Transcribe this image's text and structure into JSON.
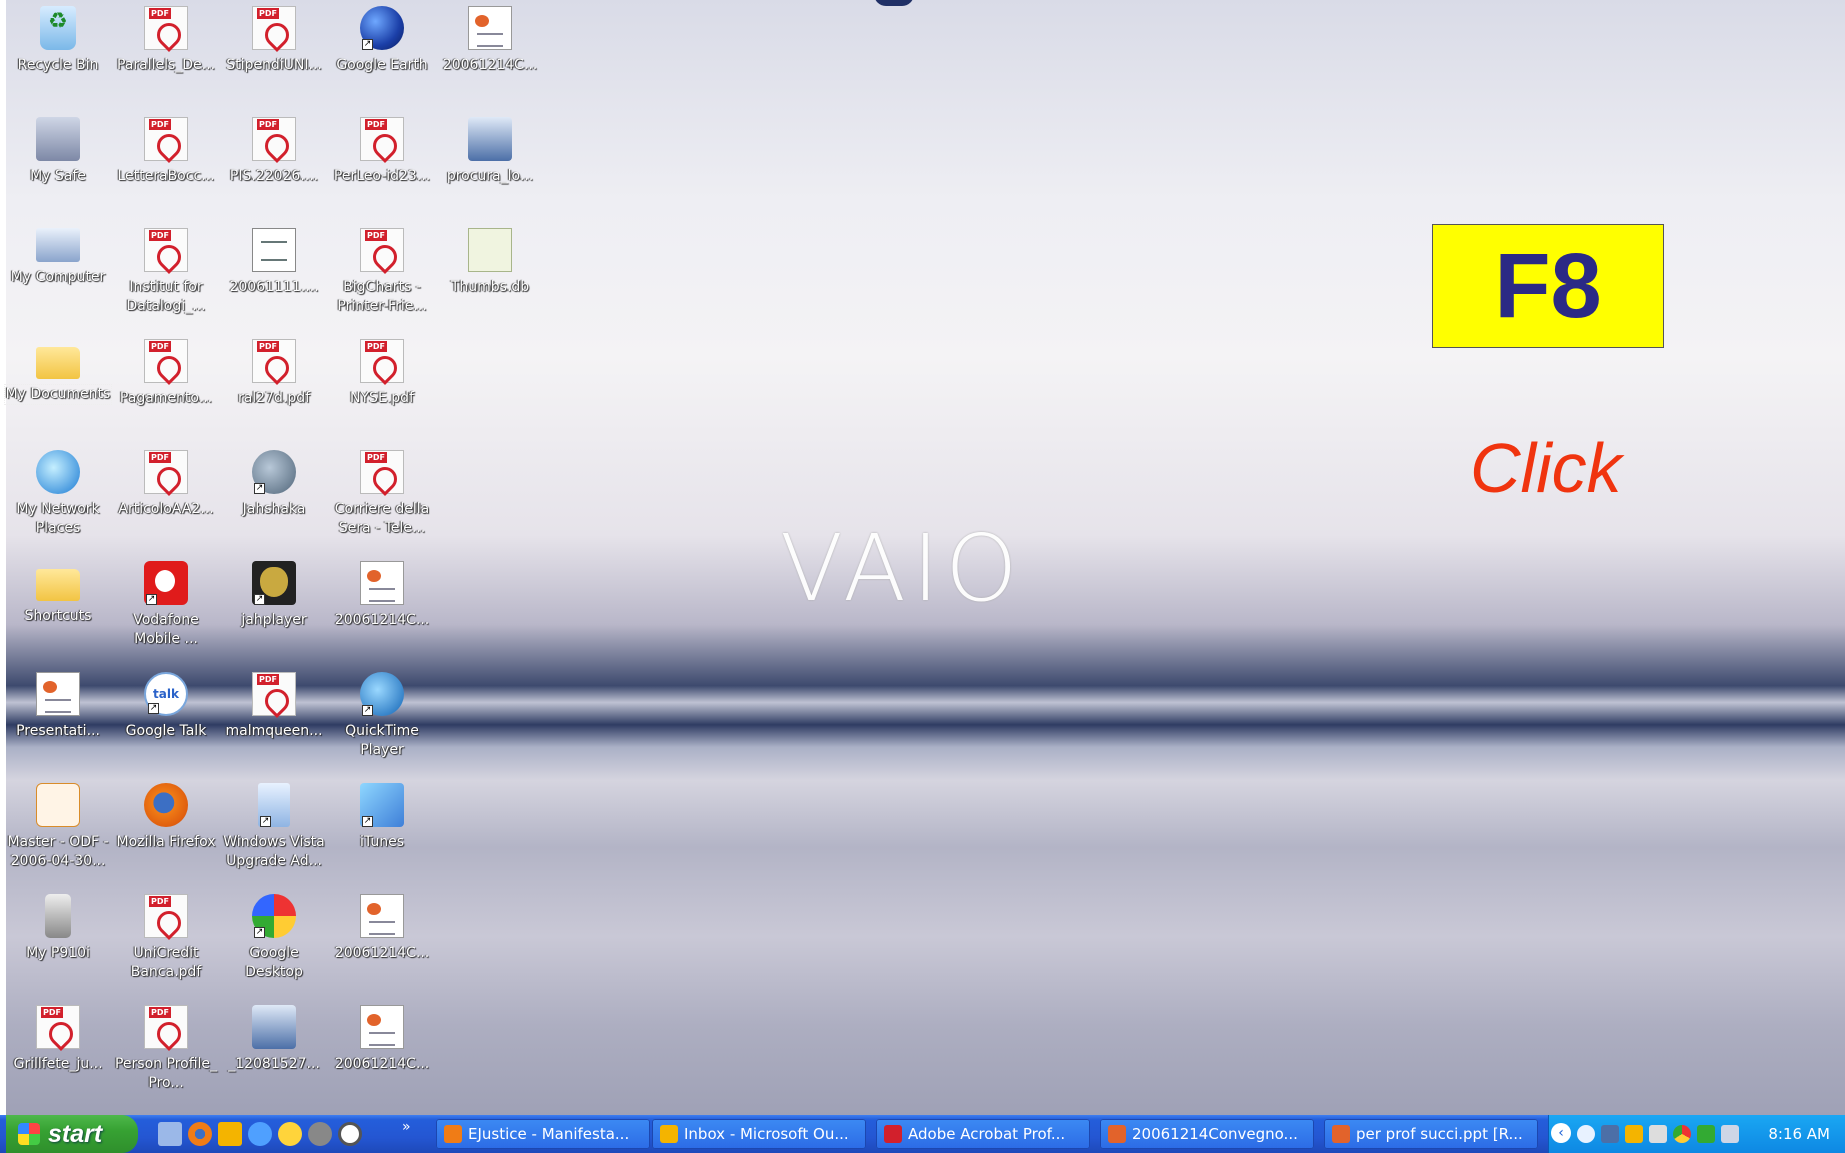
{
  "desktop": {
    "brand_logo": "VAIO",
    "icons": [
      {
        "label": "Recycle Bin",
        "type": "recycle"
      },
      {
        "label": "Parallels_De...",
        "type": "pdf"
      },
      {
        "label": "StipendiUNI...",
        "type": "pdf"
      },
      {
        "label": "Google Earth",
        "type": "globe",
        "shortcut": true
      },
      {
        "label": "20061214C...",
        "type": "doc"
      },
      {
        "label": "My Safe",
        "type": "safe"
      },
      {
        "label": "LetteraBocc...",
        "type": "pdf"
      },
      {
        "label": "PIS.22026....",
        "type": "pdf"
      },
      {
        "label": "PerLeo-id23...",
        "type": "pdf"
      },
      {
        "label": "procura_lo...",
        "type": "procura"
      },
      {
        "label": "My Computer",
        "type": "computer"
      },
      {
        "label": "Institut for Datalogi_...",
        "type": "pdf"
      },
      {
        "label": "20061111....",
        "type": "gen"
      },
      {
        "label": "BigCharts - Printer-Frie...",
        "type": "pdf"
      },
      {
        "label": "Thumbs.db",
        "type": "db"
      },
      {
        "label": "My Documents",
        "type": "folder",
        "selected": true
      },
      {
        "label": "Pagamento...",
        "type": "pdf"
      },
      {
        "label": "ral27d.pdf",
        "type": "pdf"
      },
      {
        "label": "NYSE.pdf",
        "type": "pdf"
      },
      {
        "label": "My Network Places",
        "type": "network"
      },
      {
        "label": "ArticoloAA2...",
        "type": "pdf"
      },
      {
        "label": "Jahshaka",
        "type": "mask-blue",
        "shortcut": true
      },
      {
        "label": "Corriere della Sera - Tele...",
        "type": "pdf"
      },
      {
        "label": "Shortcuts",
        "type": "folder"
      },
      {
        "label": "Vodafone Mobile ...",
        "type": "round-red",
        "shortcut": true
      },
      {
        "label": "jahplayer",
        "type": "mask",
        "shortcut": true
      },
      {
        "label": "20061214C...",
        "type": "doc"
      },
      {
        "label": "Presentati...",
        "type": "doc"
      },
      {
        "label": "Google Talk",
        "type": "talk",
        "shortcut": true
      },
      {
        "label": "malmqueen...",
        "type": "pdf"
      },
      {
        "label": "QuickTime Player",
        "type": "qt",
        "shortcut": true
      },
      {
        "label": "Master - ODF - 2006-04-30...",
        "type": "odf"
      },
      {
        "label": "Mozilla Firefox",
        "type": "fox"
      },
      {
        "label": "Windows Vista Upgrade Ad...",
        "type": "vista",
        "shortcut": true
      },
      {
        "label": "iTunes",
        "type": "itunes",
        "shortcut": true
      },
      {
        "label": "My P910i",
        "type": "phone"
      },
      {
        "label": "UniCredit Banca.pdf",
        "type": "pdf"
      },
      {
        "label": "Google Desktop",
        "type": "gdesk",
        "shortcut": true
      },
      {
        "label": "20061214C...",
        "type": "doc"
      },
      {
        "label": "Grillfete_ju...",
        "type": "pdf"
      },
      {
        "label": "Person Profile_ Pro...",
        "type": "pdf"
      },
      {
        "label": "_12081527...",
        "type": "procura"
      },
      {
        "label": "20061214C...",
        "type": "doc"
      }
    ]
  },
  "overlay": {
    "key_label": "F8",
    "key_bg": "#ffff00",
    "key_color": "#2b2a85",
    "click_label": "Click",
    "click_color": "#f0340f"
  },
  "taskbar": {
    "start_label": "start",
    "quick_launch_more": "»",
    "tasks": [
      {
        "label": "EJustice - Manifesta...",
        "icon": "firefox-icon",
        "color": "#f07c16"
      },
      {
        "label": "Inbox - Microsoft Ou...",
        "icon": "outlook-icon",
        "color": "#f4b400"
      },
      {
        "label": "Adobe Acrobat Prof...",
        "icon": "acrobat-icon",
        "color": "#d2202c"
      },
      {
        "label": "20061214Convegno...",
        "icon": "powerpoint-icon",
        "color": "#e2632b"
      },
      {
        "label": "per prof succi.ppt [R...",
        "icon": "powerpoint-icon",
        "color": "#e2632b"
      }
    ],
    "tray_chevron": "‹",
    "clock": "8:16 AM"
  }
}
